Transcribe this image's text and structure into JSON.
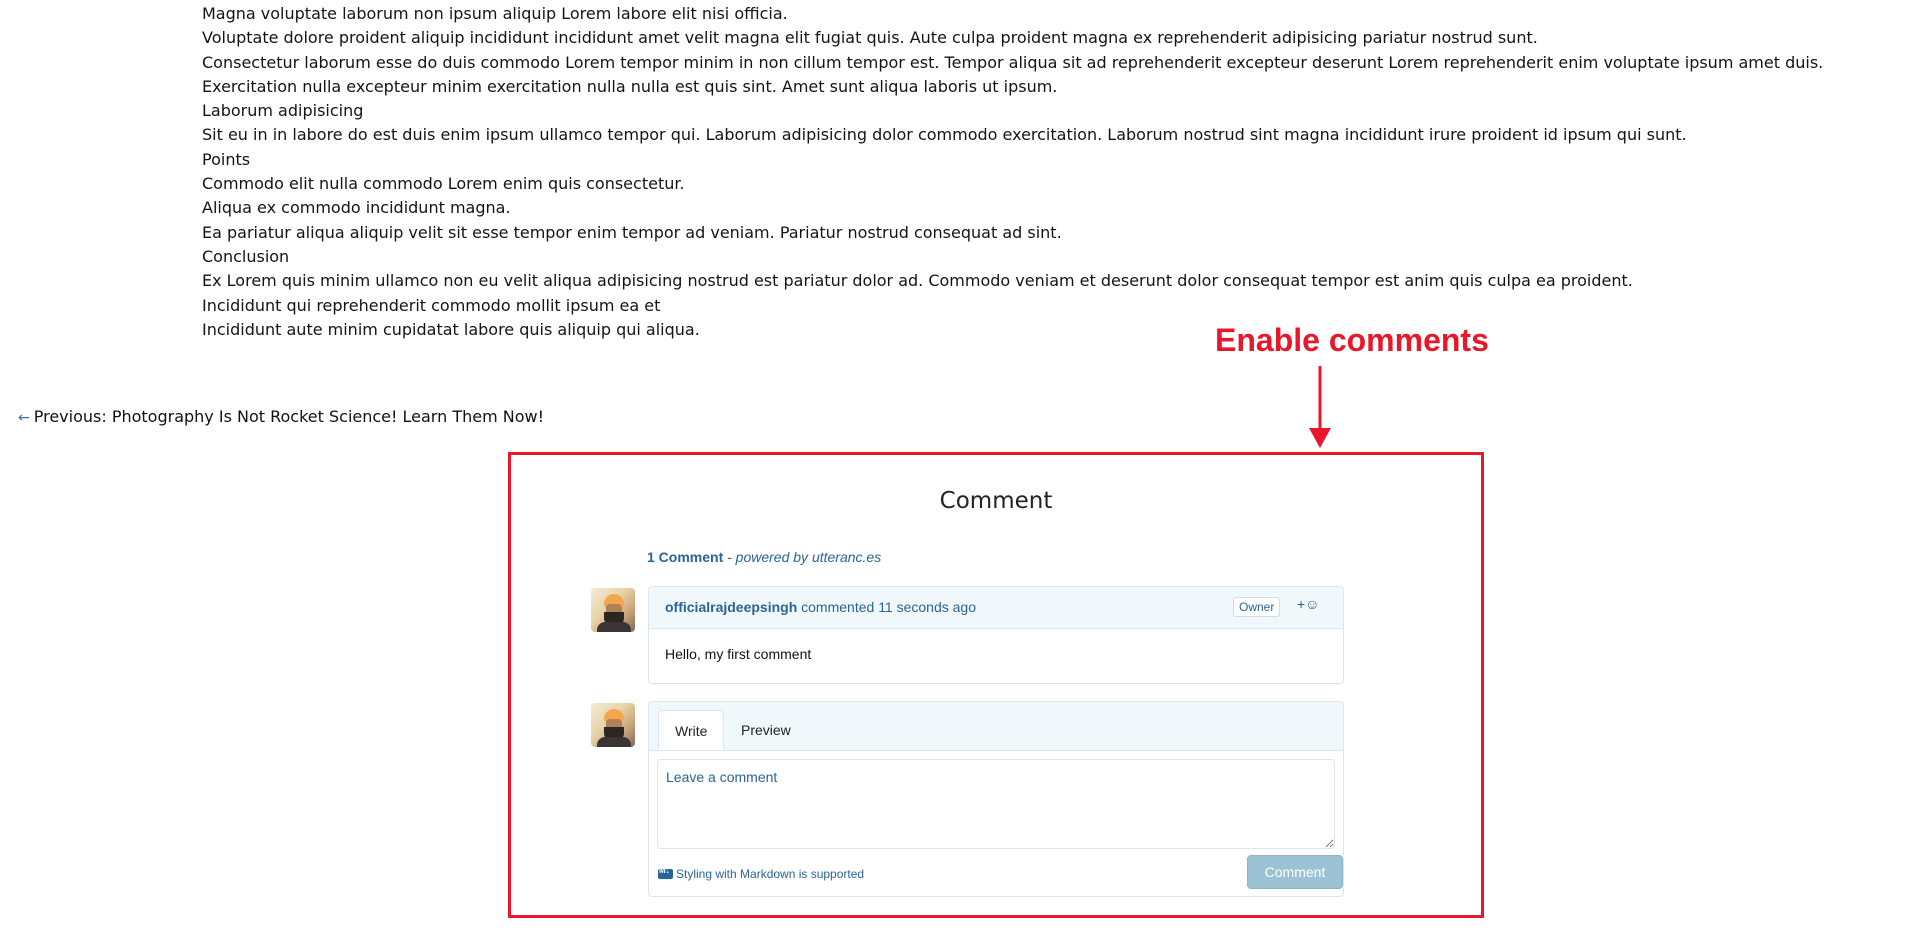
{
  "article": {
    "lines": [
      "Magna voluptate laborum non ipsum aliquip Lorem labore elit nisi officia.",
      "Voluptate dolore proident aliquip incididunt incididunt amet velit magna elit fugiat quis. Aute culpa proident magna ex reprehenderit adipisicing pariatur nostrud sunt.",
      "Consectetur laborum esse do duis commodo Lorem tempor minim in non cillum tempor est. Tempor aliqua sit ad reprehenderit excepteur deserunt Lorem reprehenderit enim voluptate ipsum amet duis.",
      "Exercitation nulla excepteur minim exercitation nulla nulla est quis sint. Amet sunt aliqua laboris ut ipsum.",
      "Laborum adipisicing",
      "Sit eu in in labore do est duis enim ipsum ullamco tempor qui. Laborum adipisicing dolor commodo exercitation. Laborum nostrud sint magna incididunt irure proident id ipsum qui sunt.",
      "Points",
      "Commodo elit nulla commodo Lorem enim quis consectetur.",
      "Aliqua ex commodo incididunt magna.",
      "Ea pariatur aliqua aliquip velit sit esse tempor enim tempor ad veniam. Pariatur nostrud consequat ad sint.",
      "Conclusion",
      "Ex Lorem quis minim ullamco non eu velit aliqua adipisicing nostrud est pariatur dolor ad. Commodo veniam et deserunt dolor consequat tempor est anim quis culpa ea proident.",
      "Incididunt qui reprehenderit commodo mollit ipsum ea et",
      "Incididunt aute minim cupidatat labore quis aliquip qui aliqua."
    ]
  },
  "nav": {
    "prev_arrow": "←",
    "prev_label": "Previous: Photography Is Not Rocket Science! Learn Them Now!"
  },
  "annotation": {
    "label": "Enable comments",
    "color": "#e8172b"
  },
  "comments": {
    "heading": "Comment",
    "count_text": "1 Comment",
    "powered_text": " - powered by utteranc.es",
    "items": [
      {
        "author": "officialrajdeepsingh",
        "action": " commented ",
        "time": "11 seconds ago",
        "badge": "Owner",
        "reaction": "+☺",
        "body": "Hello, my first comment"
      }
    ],
    "editor": {
      "tab_write": "Write",
      "tab_preview": "Preview",
      "placeholder": "Leave a comment",
      "markdown_note": "Styling with Markdown is supported",
      "submit_label": "Comment"
    }
  }
}
